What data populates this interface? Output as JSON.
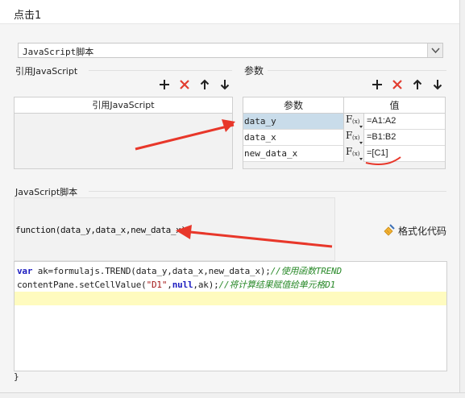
{
  "window": {
    "title": "点击1"
  },
  "script_type_select": {
    "value": "JavaScript脚本"
  },
  "ref_js": {
    "section_label": "引用JavaScript",
    "column_header": "引用JavaScript"
  },
  "params": {
    "section_label": "参数",
    "headers": {
      "name": "参数",
      "value": "值"
    },
    "rows": [
      {
        "name": "data_y",
        "fx": "F",
        "fx_sub": "(x)",
        "value": "=A1:A2"
      },
      {
        "name": "data_x",
        "fx": "F",
        "fx_sub": "(x)",
        "value": "=B1:B2"
      },
      {
        "name": "new_data_x",
        "fx": "F",
        "fx_sub": "(x)",
        "value": "=[C1]"
      }
    ]
  },
  "script": {
    "section_label": "JavaScript脚本",
    "function_signature": "function(data_y,data_x,new_data_x){",
    "format_button": "格式化代码",
    "code": {
      "line1": {
        "kw": "var",
        "body": " ak=formulajs.TREND(data_y,data_x,new_data_x);",
        "comment": "//使用函数TREND"
      },
      "line2": {
        "pre": "contentPane.setCellValue(",
        "str": "\"D1\"",
        "mid": ",",
        "kw": "null",
        "post": ",ak);",
        "comment": "//将计算结果赋值给单元格D1"
      }
    },
    "closing_brace": "}"
  },
  "colors": {
    "annotation_red": "#e8372a",
    "selected_row": "#c9dcea",
    "highlight_line": "#fffbbf",
    "delete_red": "#e23c2f"
  },
  "icons": [
    "plus-icon",
    "delete-x-icon",
    "arrow-up-icon",
    "arrow-down-icon",
    "dropdown-arrow-icon",
    "broom-icon"
  ]
}
